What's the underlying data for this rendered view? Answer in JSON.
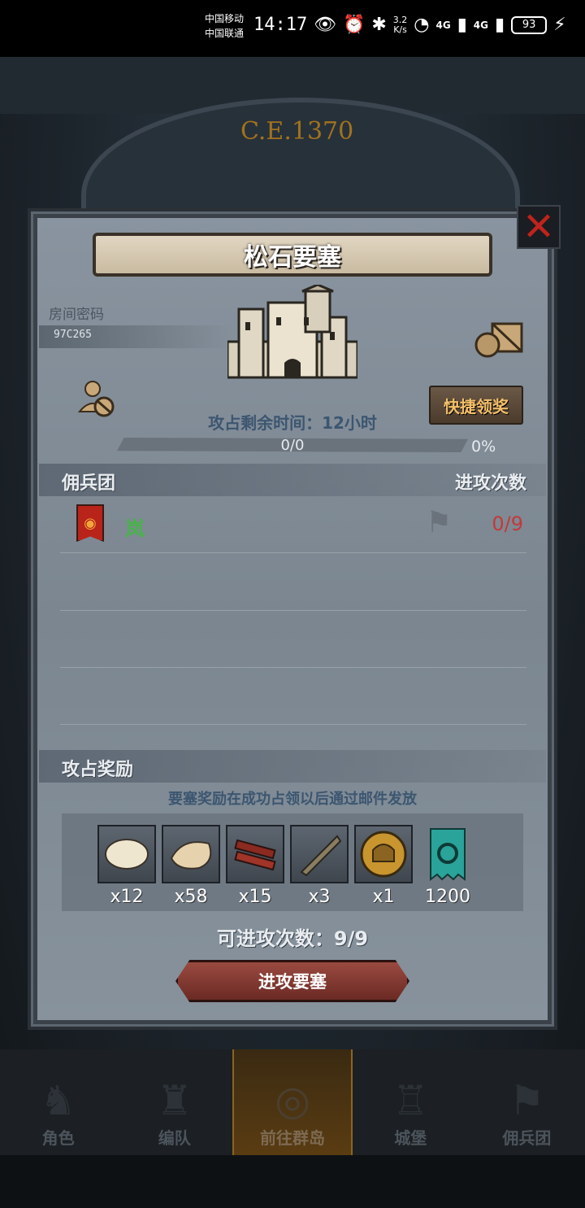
{
  "status_bar": {
    "carrier_1": "中国移动",
    "carrier_2": "中国联通",
    "time": "14:17",
    "net_speed_value": "3.2",
    "net_speed_unit": "K/s",
    "signal_1": "4G",
    "signal_2": "4G",
    "battery": "93"
  },
  "background": {
    "era": "C.E.1370"
  },
  "modal": {
    "title": "松石要塞",
    "room_label": "房间密码",
    "room_code": "97C265",
    "quick_claim": "快捷领奖",
    "remain_time": "攻占剩余时间：12小时",
    "progress": {
      "text": "0/0",
      "percent_text": "0%",
      "fraction": 0
    },
    "mercenary_header": "佣兵团",
    "attack_header": "进攻次数",
    "mercenaries": [
      {
        "name": "岚",
        "attacks": "0/9"
      }
    ],
    "rewards_header": "攻占奖励",
    "rewards_note": "要塞奖励在成功占领以后通过邮件发放",
    "rewards": [
      {
        "icon": "white-fur-icon",
        "qty": "x12"
      },
      {
        "icon": "wool-icon",
        "qty": "x58"
      },
      {
        "icon": "wood-planks-icon",
        "qty": "x15"
      },
      {
        "icon": "horn-icon",
        "qty": "x3"
      },
      {
        "icon": "gold-helmet-medal-icon",
        "qty": "x1"
      },
      {
        "icon": "guild-banner-icon",
        "qty": "1200"
      }
    ],
    "attack_times": "可进攻次数：9/9",
    "attack_button": "进攻要塞"
  },
  "bottom_nav": [
    {
      "label": "角色",
      "icon": "knight-icon"
    },
    {
      "label": "编队",
      "icon": "team-icon"
    },
    {
      "label": "前往群岛",
      "icon": "island-compass-icon",
      "active": true
    },
    {
      "label": "城堡",
      "icon": "castle-icon"
    },
    {
      "label": "佣兵团",
      "icon": "mercenary-icon"
    }
  ],
  "colors": {
    "quick_claim_text": "#f4c06a",
    "merc_name": "#49b24a",
    "attack_count": "#c23a3a",
    "close_x": "#c0231c"
  }
}
